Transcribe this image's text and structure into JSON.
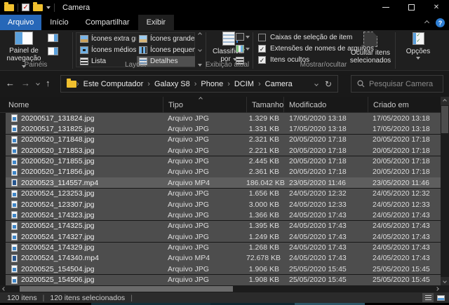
{
  "window": {
    "title": "Camera"
  },
  "tabs": {
    "file": "Arquivo",
    "items": [
      {
        "label": "Início"
      },
      {
        "label": "Compartilhar"
      },
      {
        "label": "Exibir"
      }
    ],
    "active": "Exibir"
  },
  "ribbon": {
    "paineis": {
      "group_label": "Painéis",
      "nav_pane_line1": "Painel de",
      "nav_pane_line2": "navegação"
    },
    "layout": {
      "group_label": "Layout",
      "items": [
        {
          "label": "Ícones extra grandes",
          "icon": "pic",
          "selected": false
        },
        {
          "label": "Ícones grandes",
          "icon": "pic2",
          "selected": false
        },
        {
          "label": "Ícones médios",
          "icon": "grid2",
          "selected": false
        },
        {
          "label": "Ícones pequenos",
          "icon": "grid3",
          "selected": false
        },
        {
          "label": "Lista",
          "icon": "rows",
          "selected": false
        },
        {
          "label": "Detalhes",
          "icon": "det",
          "selected": true
        }
      ]
    },
    "exibicao": {
      "group_label": "Exibição atual",
      "sort_line1": "Classificar",
      "sort_line2": "por"
    },
    "mostrar": {
      "group_label": "Mostrar/ocultar",
      "checkboxes": [
        {
          "label": "Caixas de seleção de item",
          "checked": false
        },
        {
          "label": "Extensões de nomes de arquivos",
          "checked": true
        },
        {
          "label": "Itens ocultos",
          "checked": true
        }
      ],
      "hide_line1": "Ocultar itens",
      "hide_line2": "selecionados"
    },
    "opcoes": {
      "label": "Opções"
    }
  },
  "address": {
    "breadcrumb": [
      "Este Computador",
      "Galaxy S8",
      "Phone",
      "DCIM",
      "Camera"
    ],
    "search_placeholder": "Pesquisar Camera"
  },
  "list": {
    "columns": [
      "Nome",
      "Tipo",
      "Tamanho",
      "Modificado",
      "Criado em"
    ],
    "rows": [
      {
        "name": "20200517_131824.jpg",
        "type": "Arquivo JPG",
        "size": "1.329 KB",
        "modified": "17/05/2020 13:18",
        "created": "17/05/2020 13:18",
        "kind": "jpg",
        "highlight": false
      },
      {
        "name": "20200517_131825.jpg",
        "type": "Arquivo JPG",
        "size": "1.331 KB",
        "modified": "17/05/2020 13:18",
        "created": "17/05/2020 13:18",
        "kind": "jpg",
        "highlight": false
      },
      {
        "name": "20200520_171848.jpg",
        "type": "Arquivo JPG",
        "size": "2.321 KB",
        "modified": "20/05/2020 17:18",
        "created": "20/05/2020 17:18",
        "kind": "jpg",
        "highlight": false
      },
      {
        "name": "20200520_171853.jpg",
        "type": "Arquivo JPG",
        "size": "2.221 KB",
        "modified": "20/05/2020 17:18",
        "created": "20/05/2020 17:18",
        "kind": "jpg",
        "highlight": false
      },
      {
        "name": "20200520_171855.jpg",
        "type": "Arquivo JPG",
        "size": "2.445 KB",
        "modified": "20/05/2020 17:18",
        "created": "20/05/2020 17:18",
        "kind": "jpg",
        "highlight": false
      },
      {
        "name": "20200520_171856.jpg",
        "type": "Arquivo JPG",
        "size": "2.361 KB",
        "modified": "20/05/2020 17:18",
        "created": "20/05/2020 17:18",
        "kind": "jpg",
        "highlight": false
      },
      {
        "name": "20200523_114557.mp4",
        "type": "Arquivo MP4",
        "size": "186.042 KB",
        "modified": "23/05/2020 11:46",
        "created": "23/05/2020 11:46",
        "kind": "mp4",
        "highlight": true
      },
      {
        "name": "20200524_123253.jpg",
        "type": "Arquivo JPG",
        "size": "1.656 KB",
        "modified": "24/05/2020 12:32",
        "created": "24/05/2020 12:32",
        "kind": "jpg",
        "highlight": false
      },
      {
        "name": "20200524_123307.jpg",
        "type": "Arquivo JPG",
        "size": "3.000 KB",
        "modified": "24/05/2020 12:33",
        "created": "24/05/2020 12:33",
        "kind": "jpg",
        "highlight": false
      },
      {
        "name": "20200524_174323.jpg",
        "type": "Arquivo JPG",
        "size": "1.366 KB",
        "modified": "24/05/2020 17:43",
        "created": "24/05/2020 17:43",
        "kind": "jpg",
        "highlight": false
      },
      {
        "name": "20200524_174325.jpg",
        "type": "Arquivo JPG",
        "size": "1.395 KB",
        "modified": "24/05/2020 17:43",
        "created": "24/05/2020 17:43",
        "kind": "jpg",
        "highlight": false
      },
      {
        "name": "20200524_174327.jpg",
        "type": "Arquivo JPG",
        "size": "1.249 KB",
        "modified": "24/05/2020 17:43",
        "created": "24/05/2020 17:43",
        "kind": "jpg",
        "highlight": false
      },
      {
        "name": "20200524_174329.jpg",
        "type": "Arquivo JPG",
        "size": "1.268 KB",
        "modified": "24/05/2020 17:43",
        "created": "24/05/2020 17:43",
        "kind": "jpg",
        "highlight": false
      },
      {
        "name": "20200524_174340.mp4",
        "type": "Arquivo MP4",
        "size": "72.678 KB",
        "modified": "24/05/2020 17:43",
        "created": "24/05/2020 17:43",
        "kind": "mp4",
        "highlight": false
      },
      {
        "name": "20200525_154504.jpg",
        "type": "Arquivo JPG",
        "size": "1.906 KB",
        "modified": "25/05/2020 15:45",
        "created": "25/05/2020 15:45",
        "kind": "jpg",
        "highlight": false
      },
      {
        "name": "20200525_154506.jpg",
        "type": "Arquivo JPG",
        "size": "1.908 KB",
        "modified": "25/05/2020 15:45",
        "created": "25/05/2020 15:45",
        "kind": "jpg",
        "highlight": false
      }
    ]
  },
  "status": {
    "count": "120 itens",
    "selected": "120 itens selecionados"
  },
  "colors": {
    "accent_blue": "#2667b8",
    "help_blue": "#2d7dd2",
    "selection_gray": "#4d4d4d",
    "hover_gray": "#5e5e5e",
    "folder_yellow": "#f0c02f",
    "ribbon_bg": "#1f1f1f",
    "list_bg": "#181818"
  }
}
